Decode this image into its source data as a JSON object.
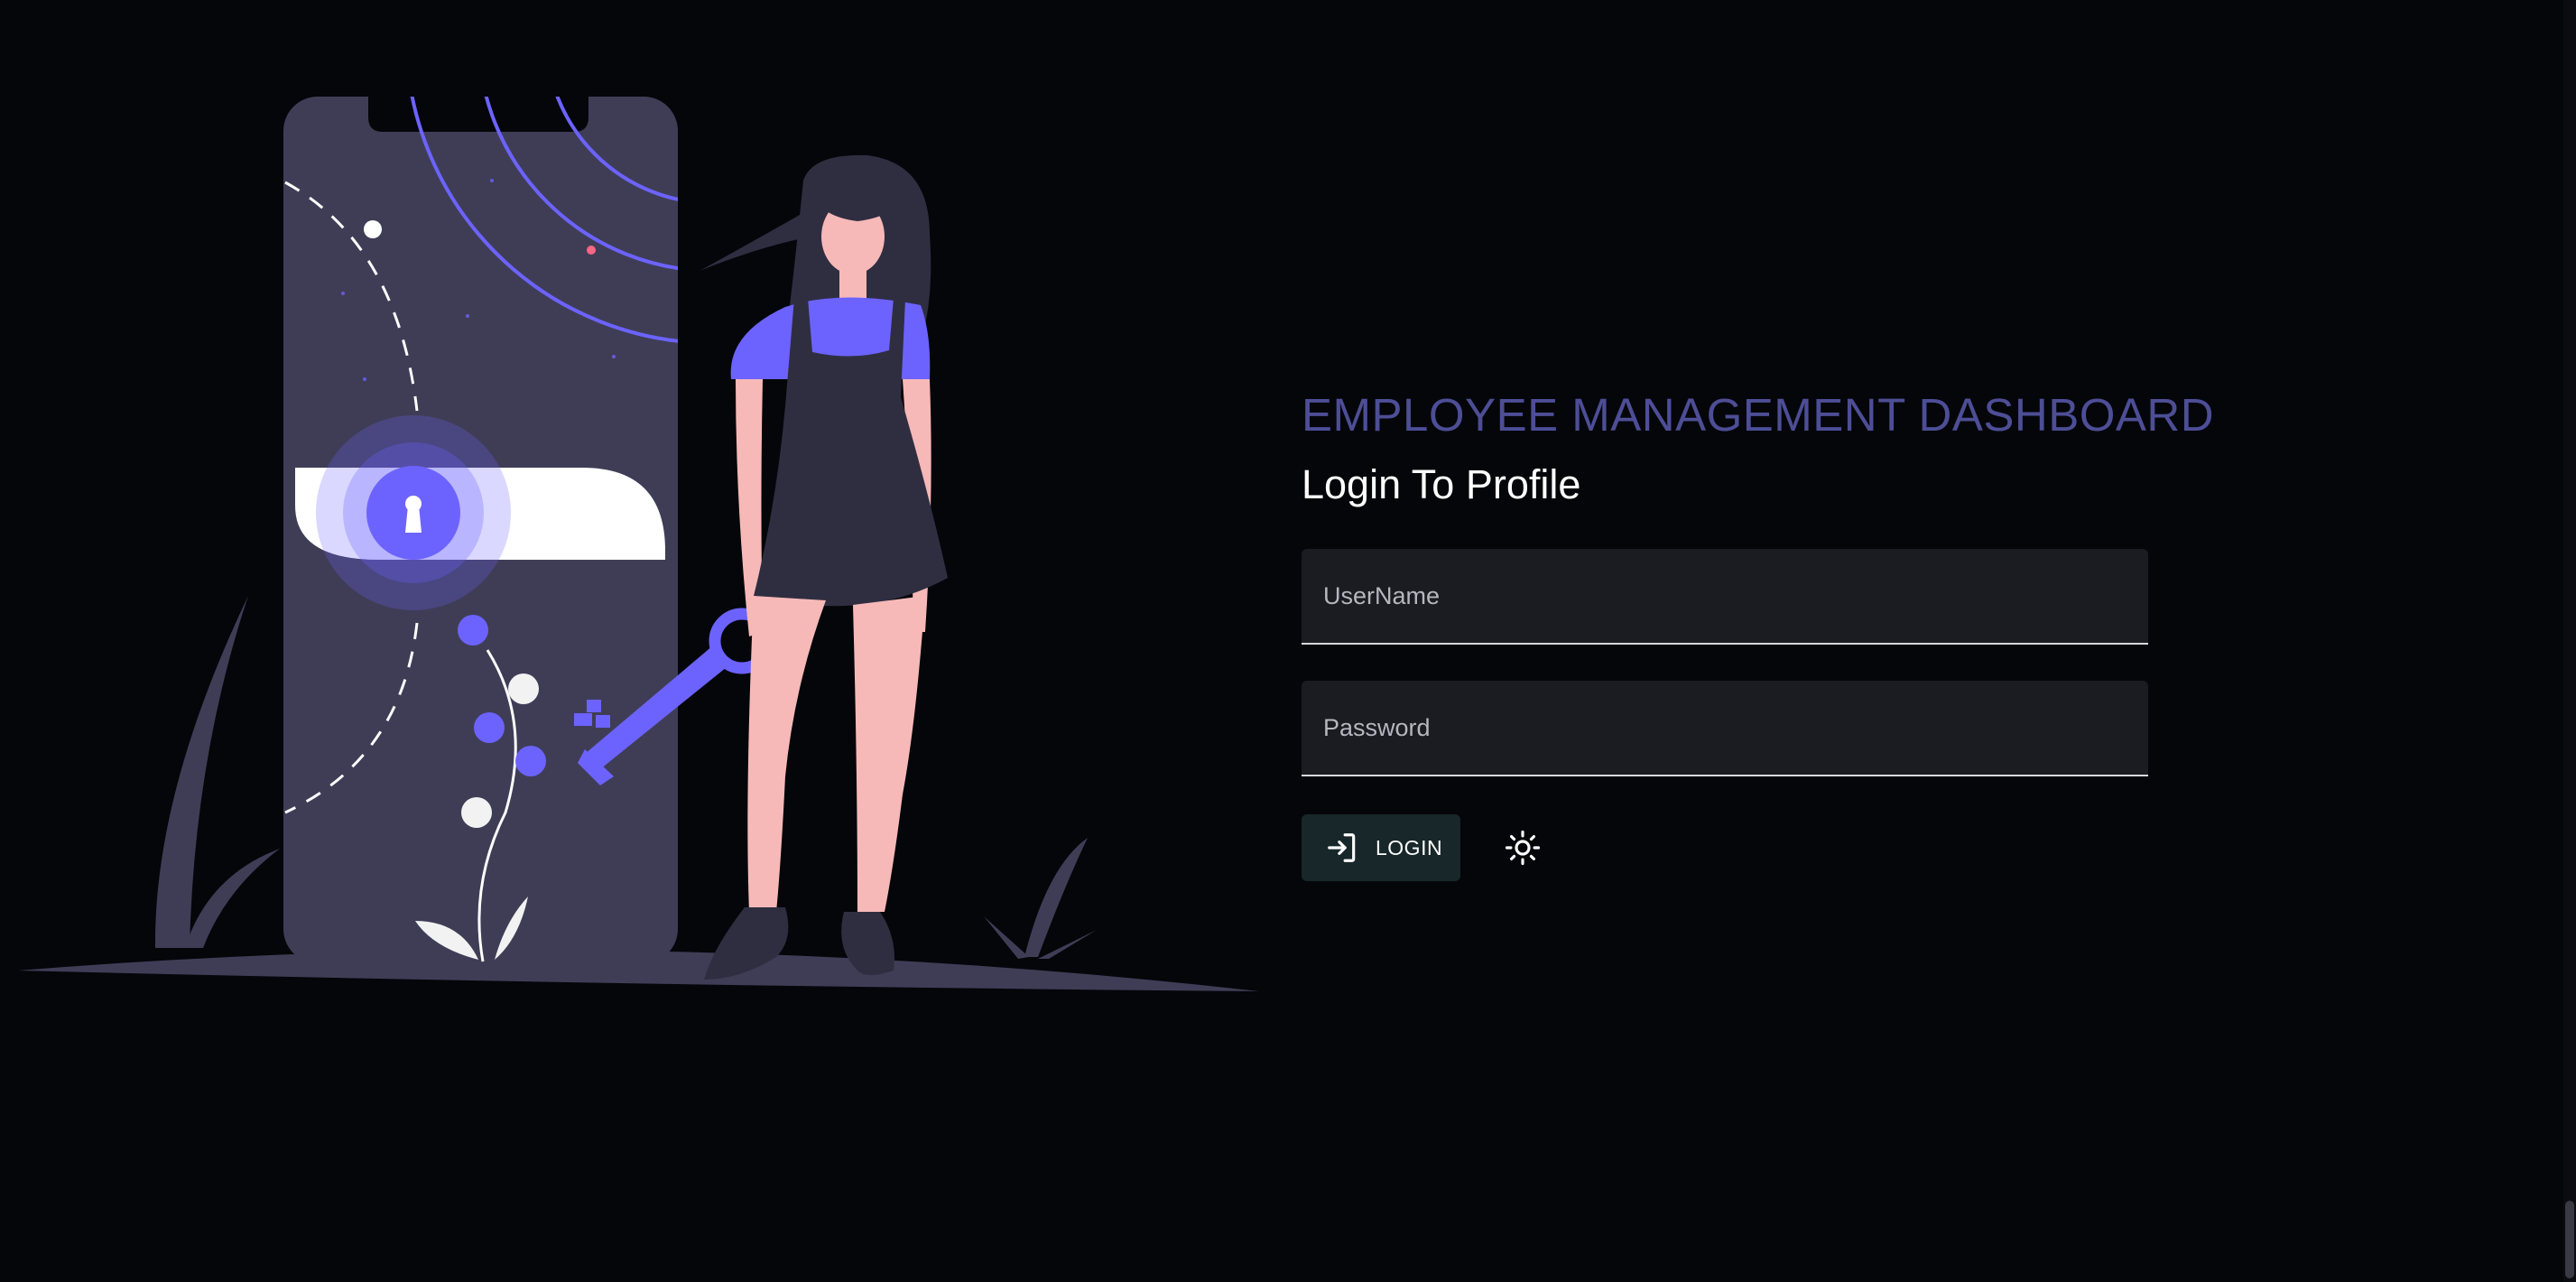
{
  "header": {
    "app_title": "EMPLOYEE MANAGEMENT DASHBOARD"
  },
  "login_form": {
    "title": "Login To Profile",
    "username": {
      "value": "",
      "placeholder": "UserName"
    },
    "password": {
      "value": "",
      "placeholder": "Password"
    },
    "submit_label": "LOGIN",
    "submit_icon": "login-arrow-icon",
    "theme_toggle_icon": "sun-icon"
  },
  "illustration": {
    "subject": "woman-holding-key-beside-locked-phone",
    "colors": {
      "accent": "#6c63ff",
      "phone": "#3f3d56",
      "ground": "#3f3d56",
      "skin": "#f6b9b8",
      "hair": "#2f2e41",
      "white": "#ffffff"
    }
  },
  "colors": {
    "background": "#05060a",
    "title": "#4d4e96",
    "field_bg": "#1b1c21",
    "button_bg": "#18272a"
  }
}
